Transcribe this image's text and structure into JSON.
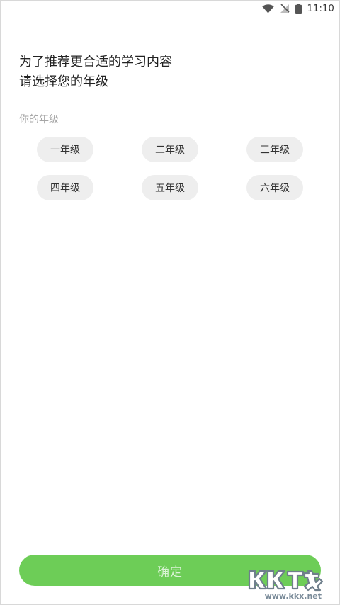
{
  "status_bar": {
    "time": "11:10",
    "icons": [
      "wifi-icon",
      "signal-off-icon",
      "battery-icon"
    ]
  },
  "heading": {
    "line1": "为了推荐更合适的学习内容",
    "line2": "请选择您的年级"
  },
  "section_label": "你的年级",
  "grades": [
    "一年级",
    "二年级",
    "三年级",
    "四年级",
    "五年级",
    "六年级"
  ],
  "confirm_label": "确定",
  "colors": {
    "accent": "#6dcd57",
    "chip_bg": "#eeeeee",
    "muted_text": "#a6a6a6"
  },
  "watermark": {
    "brand": "KK下载",
    "url": "www.kkx.net"
  }
}
